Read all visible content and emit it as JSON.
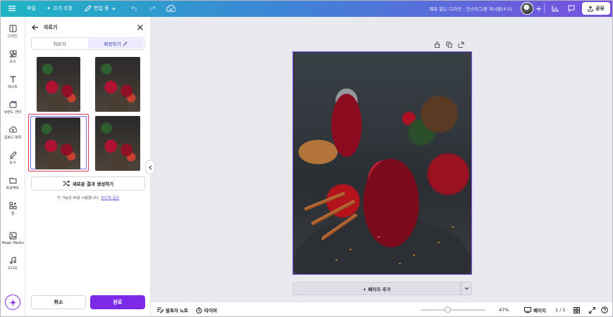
{
  "topbar": {
    "file_label": "파일",
    "resize_label": "크기 조정",
    "edit_label": "편집 중",
    "doc_title": "제목 없는 디자인 - 인스타그램 게시물(4:5)",
    "share_label": "공유"
  },
  "rail": {
    "items": [
      {
        "label": "디자인",
        "icon": "layout-icon"
      },
      {
        "label": "요소",
        "icon": "elements-icon"
      },
      {
        "label": "텍스트",
        "icon": "text-icon"
      },
      {
        "label": "브랜드 센터",
        "icon": "brand-icon"
      },
      {
        "label": "업로드 항목",
        "icon": "upload-icon"
      },
      {
        "label": "도구",
        "icon": "draw-icon"
      },
      {
        "label": "프로젝트",
        "icon": "folder-icon"
      },
      {
        "label": "앱",
        "icon": "apps-icon"
      },
      {
        "label": "Magic Media",
        "icon": "magic-media-icon"
      },
      {
        "label": "오디오",
        "icon": "audio-icon"
      }
    ]
  },
  "panel": {
    "title": "자르기",
    "tabs": [
      {
        "label": "자르기",
        "active": false
      },
      {
        "label": "확장하기",
        "active": true
      }
    ],
    "generate_label": "새로운 결과 생성하기",
    "ai_note_prefix": "이 기능은 AI를 사용합니다.",
    "ai_note_link": "피드백 공유",
    "cancel_label": "취소",
    "done_label": "완료"
  },
  "bottombar": {
    "notes_label": "발표자 노트",
    "timer_label": "타이머",
    "zoom_text": "47%",
    "pages_label": "페이지",
    "page_count": "1 / 1"
  },
  "canvas": {
    "add_page_label": "+ 페이지 추가"
  },
  "colors": {
    "accent": "#7d2ae8",
    "selection_red": "#e23a5a",
    "topbar_start": "#1fb5c4",
    "topbar_end": "#7a4fe0"
  }
}
